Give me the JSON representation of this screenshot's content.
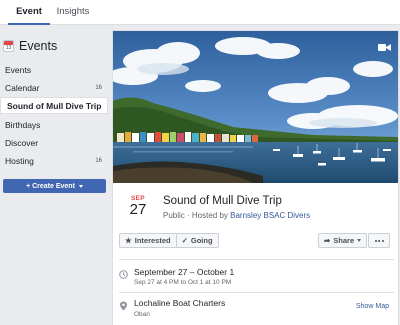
{
  "tabs": {
    "event": "Event",
    "insights": "Insights"
  },
  "sidebar": {
    "title": "Events",
    "calendar_icon_number": "13",
    "items": [
      {
        "label": "Events",
        "badge": ""
      },
      {
        "label": "Calendar",
        "badge": "16"
      },
      {
        "label": "Sound of Mull Dive Trip",
        "badge": ""
      },
      {
        "label": "Birthdays",
        "badge": ""
      },
      {
        "label": "Discover",
        "badge": ""
      },
      {
        "label": "Hosting",
        "badge": "16"
      }
    ],
    "create_label": "+ Create Event"
  },
  "event": {
    "month": "SEP",
    "day": "27",
    "title": "Sound of Mull Dive Trip",
    "visibility": "Public · Hosted by ",
    "host": "Barnsley BSAC Divers",
    "interested_label": "Interested",
    "going_label": "Going",
    "share_label": "Share",
    "date_range": "September 27 – October 1",
    "time_detail": "Sep 27 at 4 PM to Oct 1 at 10 PM",
    "location_name": "Lochaline Boat Charters",
    "location_city": "Oban",
    "show_map_label": "Show Map"
  },
  "colors": {
    "accent": "#4267b2",
    "calendar_red": "#e4464d",
    "link": "#365899"
  }
}
